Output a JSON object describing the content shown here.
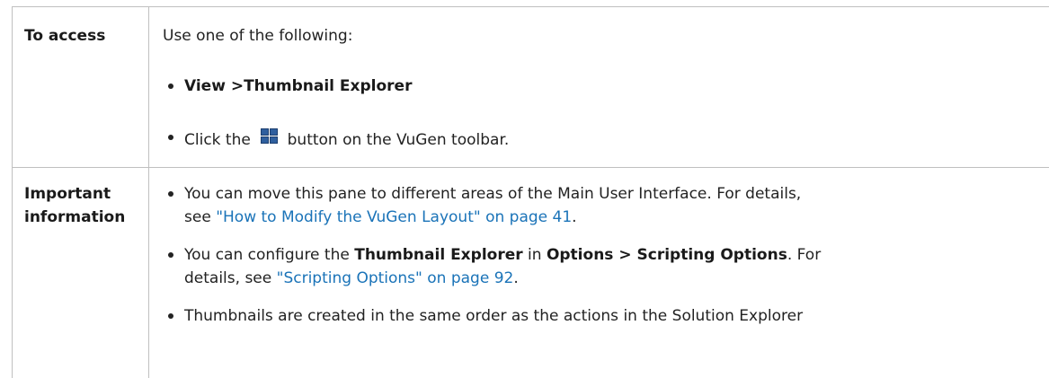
{
  "rows": [
    {
      "header": "To access",
      "intro": "Use one of the following:",
      "bullets": [
        {
          "bold": "View >Thumbnail Explorer"
        },
        {
          "before": "Click the",
          "icon": "thumbnail-explorer-icon",
          "after": "button on the VuGen toolbar."
        }
      ]
    },
    {
      "header_line1": "Important",
      "header_line2": "information",
      "bullets": [
        {
          "line1": "You can move this pane to different areas of the Main User Interface. For details,",
          "line2_prefix": "see",
          "link": "\"How to Modify the VuGen Layout\" on page 41",
          "line2_suffix": "."
        },
        {
          "l1_a": "You can configure the",
          "l1_b": "Thumbnail Explorer",
          "l1_c": "in",
          "l1_d": "Options > Scripting Options",
          "l1_e": ". For",
          "line2_prefix": "details, see",
          "link": "\"Scripting Options\" on page 92",
          "line2_suffix": "."
        },
        {
          "line1": "Thumbnails are created in the same order as the actions in the Solution Explorer"
        }
      ]
    }
  ]
}
